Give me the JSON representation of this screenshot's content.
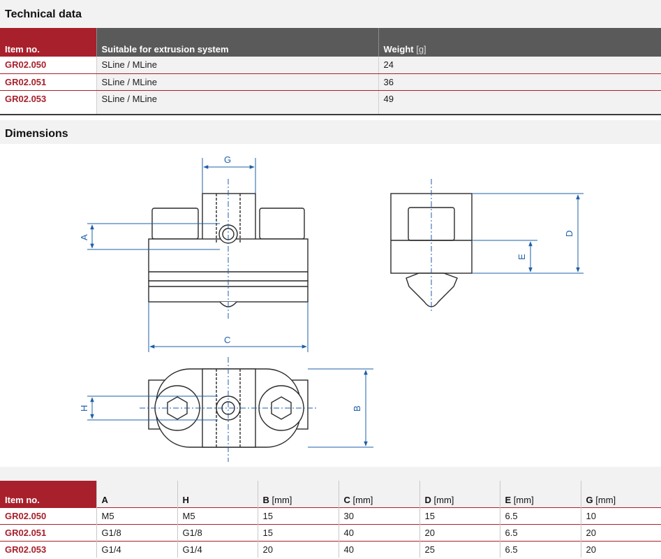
{
  "technical_data": {
    "title": "Technical data",
    "headers": {
      "item_no": "Item no.",
      "suitable": "Suitable for extrusion system",
      "weight": "Weight",
      "weight_unit": "[g]"
    },
    "rows": [
      {
        "item": "GR02.050",
        "system": "SLine / MLine",
        "weight": "24"
      },
      {
        "item": "GR02.051",
        "system": "SLine / MLine",
        "weight": "36"
      },
      {
        "item": "GR02.053",
        "system": "SLine / MLine",
        "weight": "49"
      }
    ]
  },
  "dimensions": {
    "title": "Dimensions",
    "drawing_labels": {
      "a": "A",
      "b": "B",
      "c": "C",
      "d": "D",
      "e": "E",
      "g": "G",
      "h": "H"
    },
    "headers": {
      "item_no": "Item no.",
      "a": "A",
      "h": "H",
      "b": "B",
      "c": "C",
      "d": "D",
      "e": "E",
      "g": "G",
      "unit": "[mm]"
    },
    "rows": [
      {
        "item": "GR02.050",
        "a": "M5",
        "h": "M5",
        "b": "15",
        "c": "30",
        "d": "15",
        "e": "6.5",
        "g": "10"
      },
      {
        "item": "GR02.051",
        "a": "G1/8",
        "h": "G1/8",
        "b": "15",
        "c": "40",
        "d": "20",
        "e": "6.5",
        "g": "20"
      },
      {
        "item": "GR02.053",
        "a": "G1/4",
        "h": "G1/4",
        "b": "20",
        "c": "40",
        "d": "25",
        "e": "6.5",
        "g": "20"
      }
    ]
  },
  "colors": {
    "accent": "#a8202c",
    "header_gray": "#5a5a5a",
    "dimension_blue": "#1e5fa8"
  }
}
